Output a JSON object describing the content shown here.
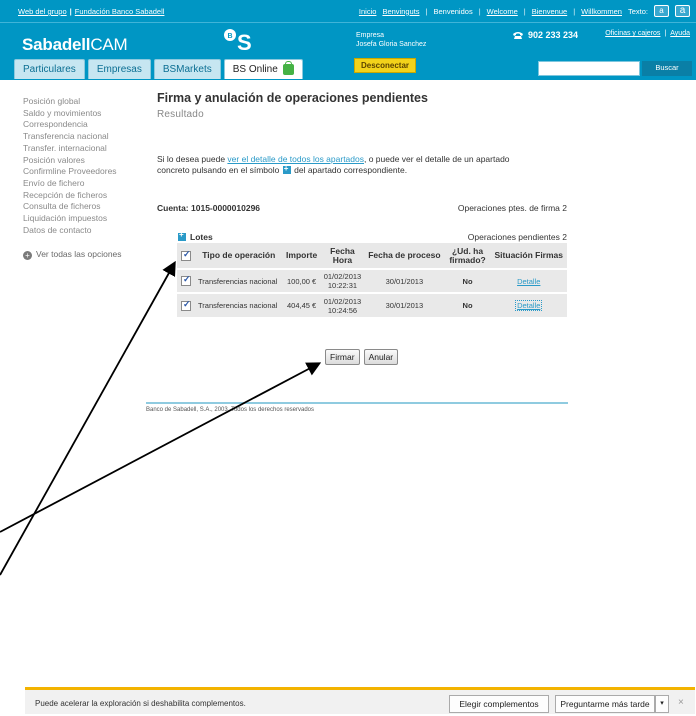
{
  "topbar": {
    "left_links": [
      "Web del grupo",
      "|",
      "Fundación Banco Sabadell"
    ],
    "right_links": [
      "Inicio",
      "Benvinguts",
      "Benvenidos",
      "Welcome",
      "Bienvenue",
      "Willkommen"
    ],
    "text_label": "Texto:",
    "font_small": "a",
    "font_large": "a"
  },
  "header": {
    "brand_bold": "Sabadell",
    "brand_rest": "CAM",
    "logo_text": "ᴮS",
    "user_company": "Empresa",
    "user_name": "Josefa Gloria Sanchez",
    "logout": "Desconectar",
    "phone": "902 233 234",
    "links": [
      "Oficinas y cajeros",
      "|",
      "Ayuda"
    ],
    "search_button": "Buscar",
    "search_value": ""
  },
  "tabs": [
    "Particulares",
    "Empresas",
    "BSMarkets",
    "BS Online"
  ],
  "sidebar": {
    "items": [
      "Posición global",
      "Saldo y movimientos",
      "Correspondencia",
      "Transferencia nacional",
      "Transfer. internacional",
      "Posición valores",
      "Confirmline Proveedores",
      "Envío de fichero",
      "Recepción de ficheros",
      "Consulta de ficheros",
      "Liquidación impuestos",
      "Datos de contacto"
    ],
    "more": "Ver todas las opciones"
  },
  "main": {
    "title": "Firma y anulación de operaciones pendientes",
    "subtitle": "Resultado",
    "info_1": "Si lo desea puede ",
    "info_link": "ver el detalle de todos los apartados",
    "info_2": ", o puede ver el detalle de un apartado",
    "info_3": "concreto pulsando en el símbolo",
    "info_4": " del apartado correspondiente.",
    "cuenta_label": "Cuenta:",
    "cuenta_value": "1015-0000010296",
    "pending_sign": "Operaciones ptes. de firma 2",
    "lotes": "Lotes",
    "pending_ops": "Operaciones pendientes 2",
    "columns": [
      "Tipo de operación",
      "Importe",
      "Fecha Hora",
      "Fecha de proceso",
      "¿Ud. ha firmado?",
      "Situación Firmas"
    ],
    "rows": [
      {
        "tipo": "Transferencias nacional",
        "importe": "100,00 €",
        "fecha": "01/02/2013",
        "hora": "10:22:31",
        "proceso": "30/01/2013",
        "firmado": "No",
        "situacion": "Detalle"
      },
      {
        "tipo": "Transferencias nacional",
        "importe": "404,45 €",
        "fecha": "01/02/2013",
        "hora": "10:24:56",
        "proceso": "30/01/2013",
        "firmado": "No",
        "situacion": "Detalle"
      }
    ],
    "btn_sign": "Firmar",
    "btn_cancel": "Anular",
    "footer": "Banco de Sabadell, S.A., 2003. Todos los derechos reservados"
  },
  "notification": {
    "message": "Puede acelerar la exploración si deshabilita complementos.",
    "btn_choose": "Elegir complementos",
    "btn_later": "Preguntarme más tarde",
    "dropdown": "▾",
    "close": "×"
  }
}
